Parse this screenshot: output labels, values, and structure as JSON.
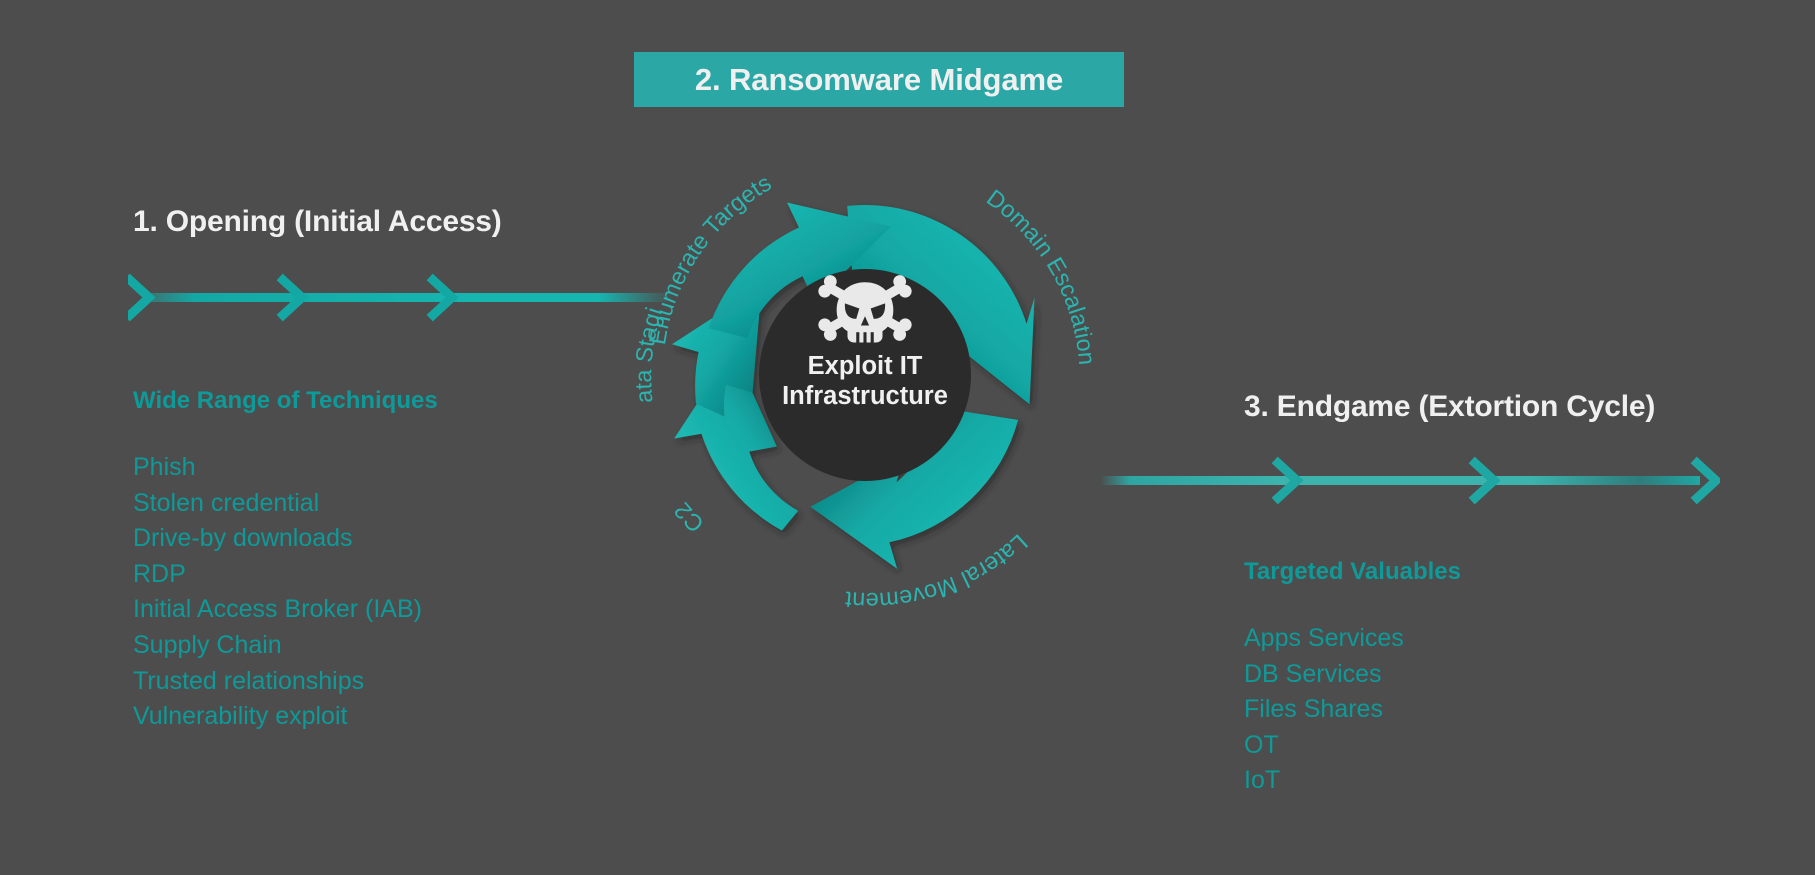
{
  "background_color": "#4d4d4d",
  "accent_color": "#0e9a99",
  "accent_bright": "#17bdb8",
  "banner_color": "#2ba8a6",
  "text_light": "#f0f0f0",
  "core_color": "#2b2b2b",
  "midgame": {
    "banner_label": "2. Ransomware Midgame"
  },
  "opening": {
    "heading": "1. Opening (Initial Access)",
    "sub_heading": "Wide Range of Techniques",
    "items": [
      "Phish",
      "Stolen credential",
      "Drive-by downloads",
      "RDP",
      "Initial Access Broker (IAB)",
      "Supply Chain",
      "Trusted relationships",
      "Vulnerability exploit"
    ],
    "arrow_direction": "right",
    "arrow_chevrons": 3
  },
  "endgame": {
    "heading": "3. Endgame (Extortion Cycle)",
    "sub_heading": "Targeted Valuables",
    "items": [
      "Apps Services",
      "DB Services",
      "Files Shares",
      "OT",
      "IoT"
    ],
    "arrow_direction": "right",
    "arrow_chevrons": 3
  },
  "cycle": {
    "center_icon": "skull-and-crossbones-icon",
    "center_line1": "Exploit  IT",
    "center_line2": "Infrastructure",
    "stages": [
      {
        "label": "Enumerate Targets",
        "position": "top-left"
      },
      {
        "label": "Domain Escalation",
        "position": "right-upper"
      },
      {
        "label": "Lateral Movement",
        "position": "bottom-right"
      },
      {
        "label": "C2",
        "position": "bottom-left"
      },
      {
        "label": "Data Staging",
        "position": "left"
      }
    ],
    "segment_count": 5,
    "rotation": "clockwise"
  }
}
